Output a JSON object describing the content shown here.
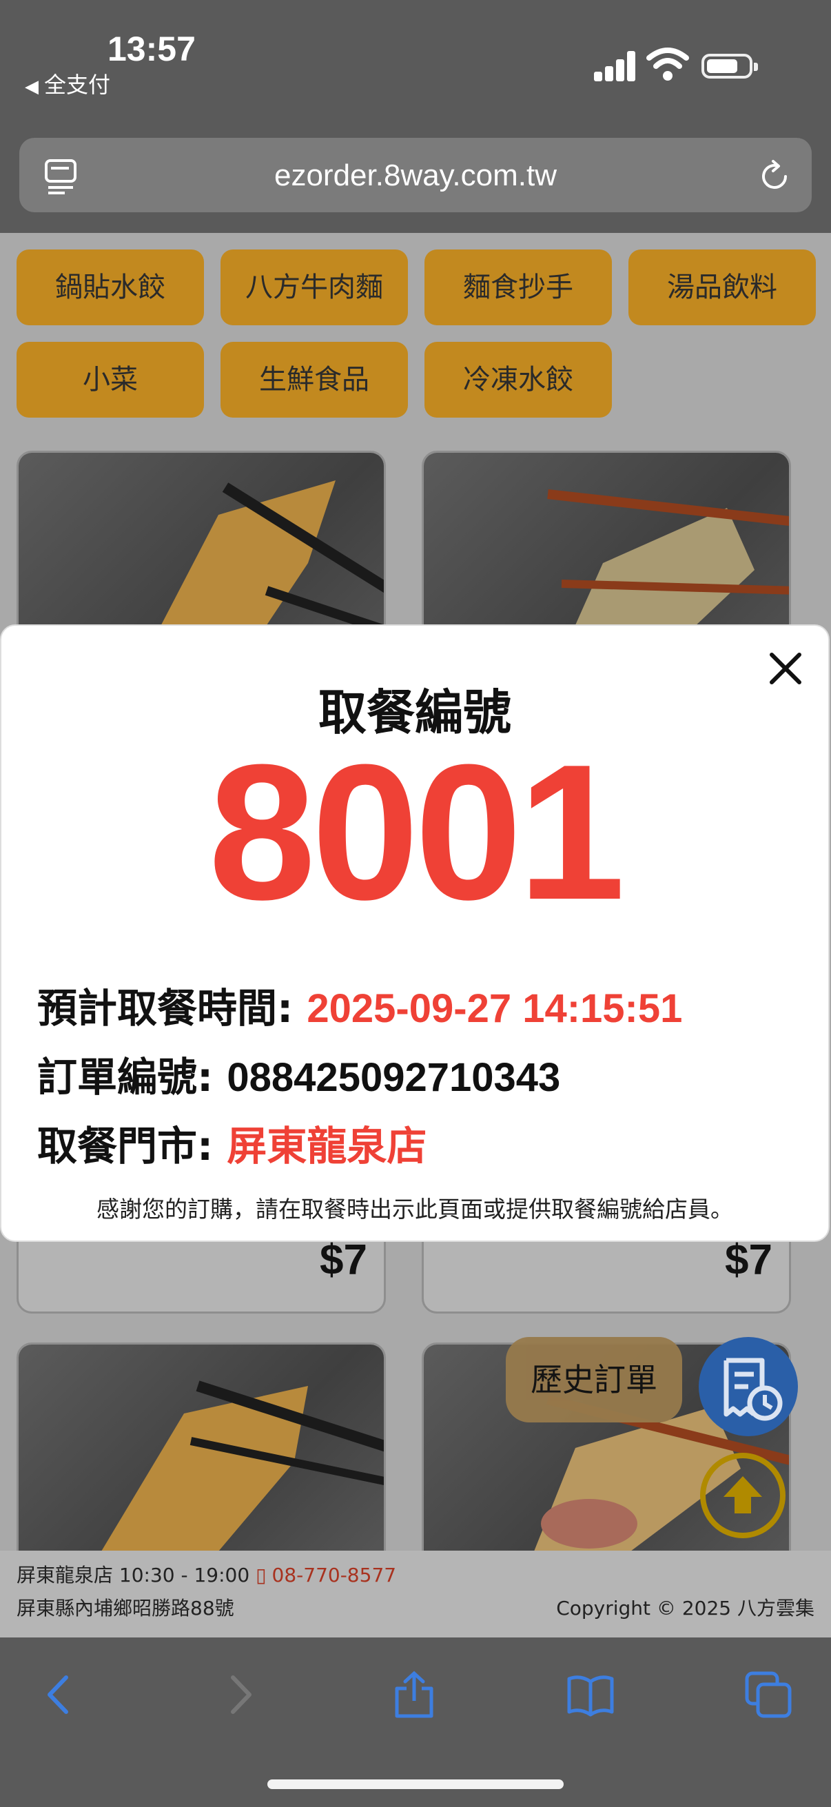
{
  "status_bar": {
    "time": "13:57",
    "back_app": "全支付"
  },
  "browser": {
    "url": "ezorder.8way.com.tw",
    "icons": [
      "tabs-icon",
      "reload-icon"
    ],
    "toolbar_icons": [
      "back-icon",
      "forward-icon",
      "share-icon",
      "bookmarks-icon",
      "tabs-overview-icon"
    ]
  },
  "categories": [
    "鍋貼水餃",
    "八方牛肉麵",
    "麵食抄手",
    "湯品飲料",
    "小菜",
    "生鮮食品",
    "冷凍水餃"
  ],
  "products": [
    {
      "price": "$7"
    },
    {
      "price": "$7"
    }
  ],
  "floating": {
    "history_label": "歷史訂單"
  },
  "footer": {
    "store_hours": "屏東龍泉店 10:30 - 19:00",
    "phone": "08-770-8577",
    "address": "屏東縣內埔鄉昭勝路88號",
    "copyright": "Copyright © 2025 八方雲集"
  },
  "modal": {
    "title": "取餐編號",
    "pickup_number": "8001",
    "pickup_time_label": "預計取餐時間:",
    "pickup_time": "2025-09-27 14:15:51",
    "order_label": "訂單編號:",
    "order_number": "088425092710343",
    "store_label": "取餐門市:",
    "store_name": "屏東龍泉店",
    "note": "感謝您的訂購，請在取餐時出示此頁面或提供取餐編號給店員。"
  },
  "colors": {
    "accent_red": "#ef4136",
    "category_bg": "#c2891f",
    "history_blue": "#2a5fa8",
    "ios_blue": "#3d7ee0"
  }
}
